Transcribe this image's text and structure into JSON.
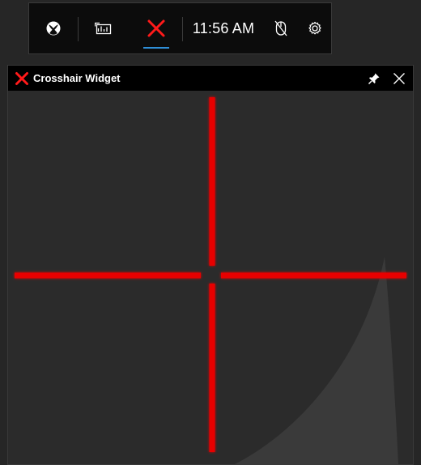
{
  "gamebar": {
    "time": "11:56 AM",
    "icons": [
      "xbox-icon",
      "performance-icon",
      "crosshair-icon",
      "mouse-icon",
      "gear-icon"
    ],
    "active_tab": "crosshair"
  },
  "widget": {
    "title": "Crosshair Widget",
    "title_icon": "crosshair-x-icon",
    "pin_icon": "pin-icon",
    "close_icon": "close-icon"
  },
  "crosshair": {
    "color": "#ff0000",
    "style": "cross-with-center-gap"
  },
  "colors": {
    "accent": "#2f8fd8",
    "crosshair": "#ff0000",
    "bar_bg": "#0c0c0c",
    "canvas_bg": "#2b2b2b"
  }
}
